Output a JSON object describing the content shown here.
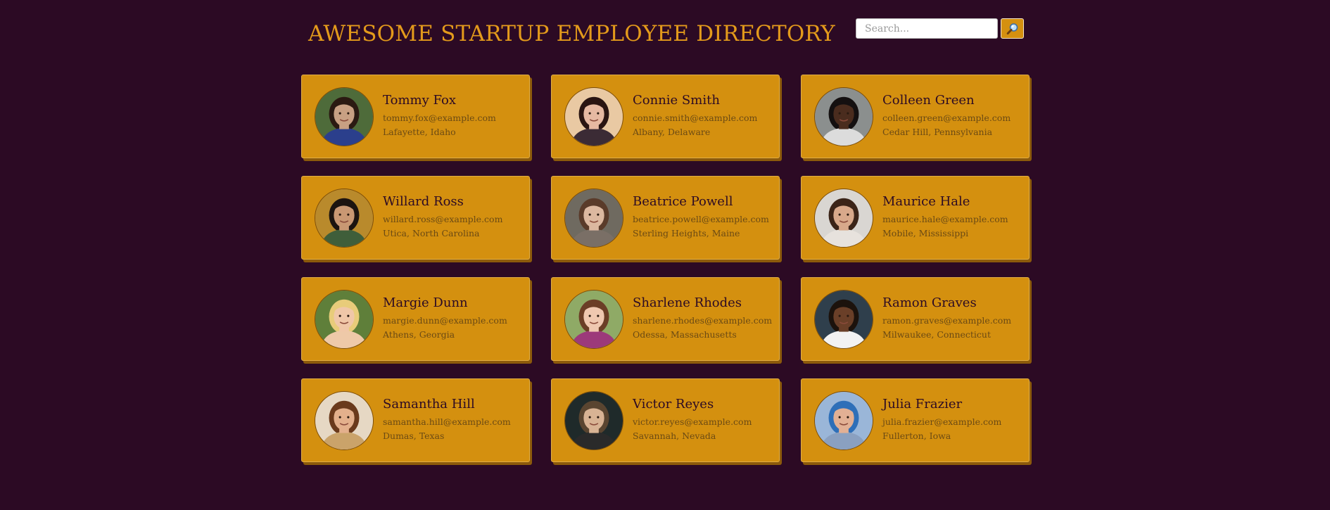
{
  "header": {
    "title": "AWESOME STARTUP EMPLOYEE DIRECTORY"
  },
  "search": {
    "placeholder": "Search...",
    "value": "",
    "button_icon": "magnifier-icon"
  },
  "colors": {
    "background": "#2c0a24",
    "accent": "#e39a1b",
    "card": "#d4900f",
    "card_shadow": "#8c5a0b"
  },
  "employees": [
    {
      "name": "Tommy Fox",
      "email": "tommy.fox@example.com",
      "location": "Lafayette, Idaho",
      "avatar": {
        "bg": "#4e6b3a",
        "skin": "#c8a083",
        "hair": "#2b1a12",
        "shirt": "#2b3f8c"
      }
    },
    {
      "name": "Connie Smith",
      "email": "connie.smith@example.com",
      "location": "Albany, Delaware",
      "avatar": {
        "bg": "#e9c9a3",
        "skin": "#e6b9a2",
        "hair": "#2a1512",
        "shirt": "#3b2b35"
      }
    },
    {
      "name": "Colleen Green",
      "email": "colleen.green@example.com",
      "location": "Cedar Hill, Pennsylvania",
      "avatar": {
        "bg": "#8b8f8e",
        "skin": "#4a2c1e",
        "hair": "#141010",
        "shirt": "#dcdcdc"
      }
    },
    {
      "name": "Willard Ross",
      "email": "willard.ross@example.com",
      "location": "Utica, North Carolina",
      "avatar": {
        "bg": "#b98a2c",
        "skin": "#c99873",
        "hair": "#1c1410",
        "shirt": "#3f5e3a"
      }
    },
    {
      "name": "Beatrice Powell",
      "email": "beatrice.powell@example.com",
      "location": "Sterling Heights, Maine",
      "avatar": {
        "bg": "#6f6a60",
        "skin": "#dcb8a0",
        "hair": "#5a3b2a",
        "shirt": "#7a6f66"
      }
    },
    {
      "name": "Maurice Hale",
      "email": "maurice.hale@example.com",
      "location": "Mobile, Mississippi",
      "avatar": {
        "bg": "#d9d6d2",
        "skin": "#d8a98b",
        "hair": "#3b2418",
        "shirt": "#e7e2dd"
      }
    },
    {
      "name": "Margie Dunn",
      "email": "margie.dunn@example.com",
      "location": "Athens, Georgia",
      "avatar": {
        "bg": "#5f7f3a",
        "skin": "#f0c7a8",
        "hair": "#e8cc7a",
        "shirt": "#eec9a8"
      }
    },
    {
      "name": "Sharlene Rhodes",
      "email": "sharlene.rhodes@example.com",
      "location": "Odessa, Massachusetts",
      "avatar": {
        "bg": "#8faa66",
        "skin": "#efc8b0",
        "hair": "#6b3e26",
        "shirt": "#9c3a7a"
      }
    },
    {
      "name": "Ramon Graves",
      "email": "ramon.graves@example.com",
      "location": "Milwaukee, Connecticut",
      "avatar": {
        "bg": "#2f3f4c",
        "skin": "#6a3f28",
        "hair": "#1c120c",
        "shirt": "#f2f2f2"
      }
    },
    {
      "name": "Samantha Hill",
      "email": "samantha.hill@example.com",
      "location": "Dumas, Texas",
      "avatar": {
        "bg": "#e6d8c4",
        "skin": "#e3b08c",
        "hair": "#6a3a1c",
        "shirt": "#caa36a"
      }
    },
    {
      "name": "Victor Reyes",
      "email": "victor.reyes@example.com",
      "location": "Savannah, Nevada",
      "avatar": {
        "bg": "#1f2a2a",
        "skin": "#d8b394",
        "hair": "#5a4530",
        "shirt": "#2a2a2a"
      }
    },
    {
      "name": "Julia Frazier",
      "email": "julia.frazier@example.com",
      "location": "Fullerton, Iowa",
      "avatar": {
        "bg": "#9ab6d8",
        "skin": "#e2b094",
        "hair": "#2e6fb8",
        "shirt": "#8aa0c0"
      }
    }
  ]
}
